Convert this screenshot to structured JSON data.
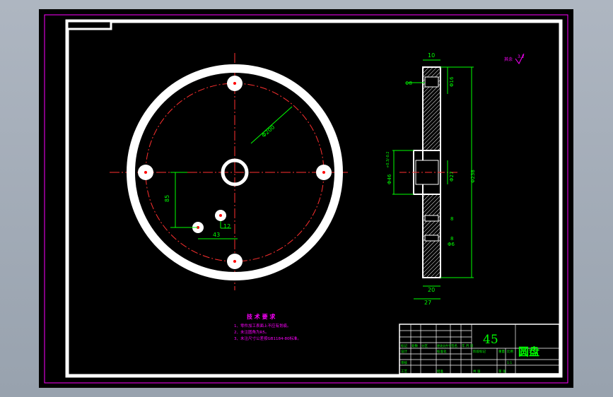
{
  "drawing": {
    "title": "圆盘",
    "material": "45",
    "surface_roughness": {
      "label": "其余",
      "value": "3.2"
    }
  },
  "dimensions": {
    "front": {
      "d_pcd": "Φ200",
      "h": "85",
      "w": "12",
      "w2": "43"
    },
    "side": {
      "top_w": "10",
      "t_bore": "Φ8",
      "d_top": "Φ16",
      "hub_d": "Φ46",
      "hub_tol": "+0.3/-0.2",
      "d_mid": "Φ27",
      "d_outer": "Φ238",
      "s_8a": "8",
      "s_8b": "8",
      "s_6": "Φ6",
      "w_bot": "20",
      "w_total": "27"
    }
  },
  "notes": {
    "heading": "技 术 要 求",
    "lines": [
      "1、零件加工表面上不应有划痕。",
      "2、未注圆角为R5。",
      "3、未注尺寸公差按GB1184-80标准。"
    ]
  },
  "title_block": {
    "cells": [
      "标记",
      "处数",
      "分区",
      "更改文件号",
      "签名",
      "年 月 日",
      "设计",
      "标准化",
      "审核",
      "工艺",
      "批准",
      "阶段标记",
      "重量",
      "比例",
      "1:1",
      "共 张",
      "第 张"
    ]
  }
}
